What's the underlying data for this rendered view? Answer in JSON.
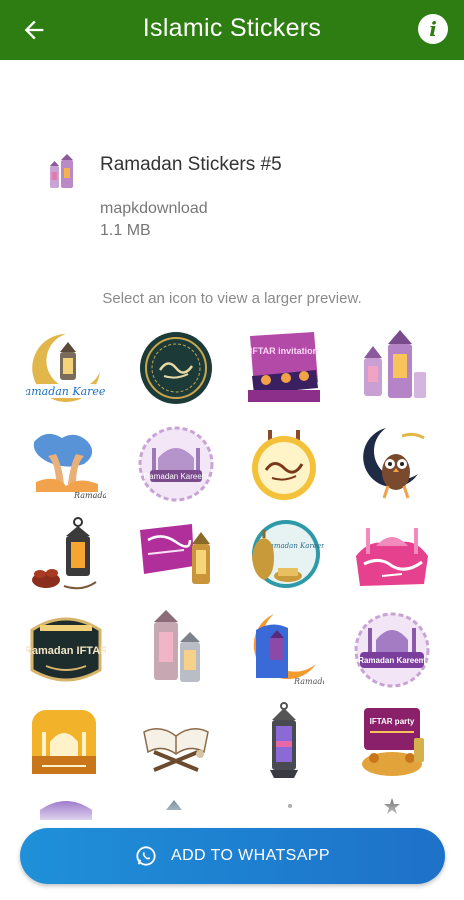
{
  "appbar": {
    "title": "Islamic Stickers",
    "info_glyph": "i"
  },
  "pack": {
    "name": "Ramadan Stickers #5",
    "publisher": "mapkdownload",
    "size": "1.1 MB"
  },
  "hint": "Select an icon to view a larger preview.",
  "stickers": [
    {
      "kind": "crescent-lantern",
      "label": "Ramadan Kareem"
    },
    {
      "kind": "round-calligraphy",
      "label": ""
    },
    {
      "kind": "iftar-invitation",
      "label": "IFTAR invitation"
    },
    {
      "kind": "lanterns",
      "label": ""
    },
    {
      "kind": "dua-hands",
      "label": "Ramadan"
    },
    {
      "kind": "mosque-badge",
      "label": "Ramadan Kareem"
    },
    {
      "kind": "arabic-badge",
      "label": ""
    },
    {
      "kind": "owl-crescent",
      "label": ""
    },
    {
      "kind": "lantern-dates",
      "label": ""
    },
    {
      "kind": "sign-lantern",
      "label": ""
    },
    {
      "kind": "teapot-badge",
      "label": "Ramadan Kareem"
    },
    {
      "kind": "pink-mosque",
      "label": ""
    },
    {
      "kind": "ramadan-iftar-badge",
      "label": "Ramadan IFTAR"
    },
    {
      "kind": "two-lanterns",
      "label": ""
    },
    {
      "kind": "crescent-scene",
      "label": "Ramadan"
    },
    {
      "kind": "purple-mosque",
      "label": "Ramadan Kareem"
    },
    {
      "kind": "sunset-mosque",
      "label": ""
    },
    {
      "kind": "quran-stand",
      "label": ""
    },
    {
      "kind": "single-lantern",
      "label": ""
    },
    {
      "kind": "iftar-party",
      "label": "IFTAR party"
    }
  ],
  "cta": {
    "label": "ADD TO WHATSAPP"
  },
  "colors": {
    "appbar": "#2e7d12",
    "cta_start": "#1f90d9",
    "cta_end": "#1e71c8"
  }
}
